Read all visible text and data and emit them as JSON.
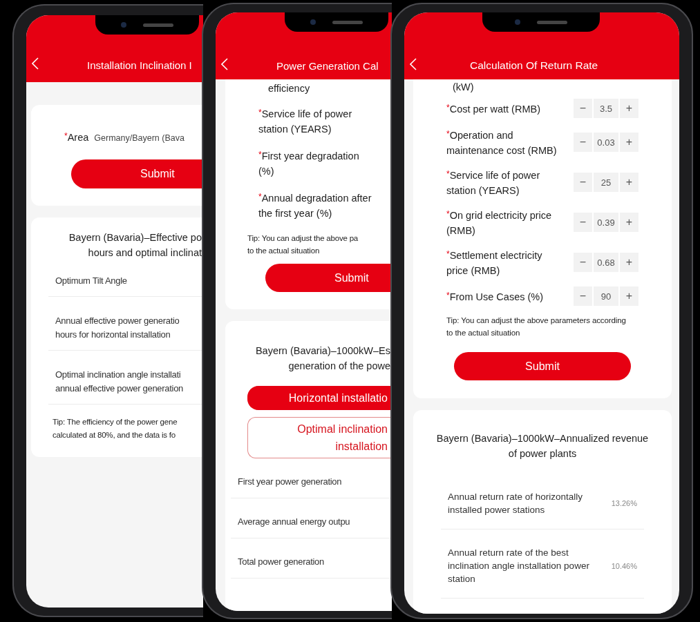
{
  "phones": [
    {
      "header": {
        "title": "Installation Inclination I"
      },
      "cards": [
        {
          "items": [
            {
              "kind": "field",
              "mark": "*",
              "label": "Area",
              "value": "Germany/Bayern (Bava"
            },
            {
              "kind": "button",
              "label": "Submit"
            }
          ]
        },
        {
          "items": [
            {
              "kind": "heading",
              "lines": [
                "Bayern (Bavaria)–Effective po",
                "hours and optimal inclinat"
              ]
            },
            {
              "kind": "row",
              "lines": [
                "Optimum Tilt Angle"
              ]
            },
            {
              "kind": "row",
              "lines": [
                "Annual effective power generatio",
                "hours for horizontal installation"
              ]
            },
            {
              "kind": "row",
              "lines": [
                "Optimal inclination angle installati",
                "annual effective power generation"
              ]
            },
            {
              "kind": "tip",
              "lines": [
                "Tip: The efficiency of the power gene",
                "calculated at 80%, and the data is fo"
              ]
            }
          ]
        }
      ]
    },
    {
      "header": {
        "title": "Power Generation Cal"
      },
      "cards": [
        {
          "items": [
            {
              "kind": "text",
              "lines": [
                "efficiency"
              ]
            },
            {
              "kind": "param",
              "mark": "*",
              "lines": [
                "Service life of power",
                "station (YEARS)"
              ]
            },
            {
              "kind": "param",
              "mark": "*",
              "lines": [
                "First year degradation",
                "(%)"
              ]
            },
            {
              "kind": "param",
              "mark": "*",
              "lines": [
                "Annual degradation after",
                "the first year (%)"
              ]
            },
            {
              "kind": "tip",
              "lines": [
                "Tip: You can adjust the above pa",
                "to the actual situation"
              ]
            },
            {
              "kind": "button",
              "label": "Submit"
            }
          ]
        },
        {
          "items": [
            {
              "kind": "heading",
              "lines": [
                "Bayern (Bavaria)–1000kW–Es",
                "generation of the powe"
              ]
            },
            {
              "kind": "option",
              "selected": true,
              "lines": [
                "Horizontal installatio"
              ]
            },
            {
              "kind": "option",
              "selected": false,
              "lines": [
                "Optimal inclination",
                "installation"
              ]
            },
            {
              "kind": "row",
              "lines": [
                "First year power generation"
              ]
            },
            {
              "kind": "row",
              "lines": [
                "Average annual energy outpu"
              ]
            },
            {
              "kind": "row",
              "lines": [
                "Total power generation"
              ]
            }
          ]
        }
      ]
    },
    {
      "header": {
        "title": "Calculation Of Return Rate"
      },
      "cards": [
        {
          "items": [
            {
              "kind": "text",
              "lines": [
                "(kW)"
              ]
            },
            {
              "kind": "param",
              "mark": "*",
              "lines": [
                "Cost per watt (RMB)"
              ],
              "minus": "−",
              "value": "3.5",
              "plus": "+"
            },
            {
              "kind": "param",
              "mark": "*",
              "lines": [
                "Operation and",
                "maintenance cost (RMB)"
              ],
              "minus": "−",
              "value": "0.03",
              "plus": "+"
            },
            {
              "kind": "param",
              "mark": "*",
              "lines": [
                "Service life of power",
                "station (YEARS)"
              ],
              "minus": "−",
              "value": "25",
              "plus": "+"
            },
            {
              "kind": "param",
              "mark": "*",
              "lines": [
                "On grid electricity price",
                "(RMB)"
              ],
              "minus": "−",
              "value": "0.39",
              "plus": "+"
            },
            {
              "kind": "param",
              "mark": "*",
              "lines": [
                "Settlement electricity",
                "price (RMB)"
              ],
              "minus": "−",
              "value": "0.68",
              "plus": "+"
            },
            {
              "kind": "param",
              "mark": "*",
              "lines": [
                "From Use Cases (%)"
              ],
              "minus": "−",
              "value": "90",
              "plus": "+"
            },
            {
              "kind": "tip",
              "lines": [
                "Tip: You can adjust the above parameters according",
                "to the actual situation"
              ]
            },
            {
              "kind": "button",
              "label": "Submit"
            }
          ]
        },
        {
          "items": [
            {
              "kind": "heading",
              "lines": [
                "Bayern (Bavaria)–1000kW–Annualized revenue",
                "of power plants"
              ]
            },
            {
              "kind": "row",
              "lines": [
                "Annual return rate of horizontally",
                "installed power stations"
              ],
              "value": "13.26%"
            },
            {
              "kind": "row",
              "lines": [
                "Annual return rate of the best",
                "inclination angle installation power",
                "station"
              ],
              "value": "10.46%"
            }
          ]
        }
      ]
    }
  ]
}
